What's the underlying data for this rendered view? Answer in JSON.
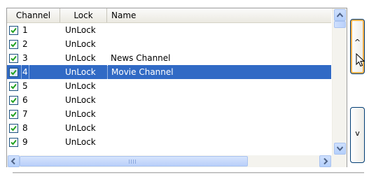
{
  "list": {
    "columns": [
      "Channel",
      "Lock",
      "Name"
    ],
    "rows": [
      {
        "channel": "1",
        "lock": "UnLock",
        "name": "",
        "checked": true,
        "selected": false
      },
      {
        "channel": "2",
        "lock": "UnLock",
        "name": "",
        "checked": true,
        "selected": false
      },
      {
        "channel": "3",
        "lock": "UnLock",
        "name": "News Channel",
        "checked": true,
        "selected": false
      },
      {
        "channel": "4",
        "lock": "UnLock",
        "name": "Movie Channel",
        "checked": true,
        "selected": true
      },
      {
        "channel": "5",
        "lock": "UnLock",
        "name": "",
        "checked": true,
        "selected": false
      },
      {
        "channel": "6",
        "lock": "UnLock",
        "name": "",
        "checked": true,
        "selected": false
      },
      {
        "channel": "7",
        "lock": "UnLock",
        "name": "",
        "checked": true,
        "selected": false
      },
      {
        "channel": "8",
        "lock": "UnLock",
        "name": "",
        "checked": true,
        "selected": false
      },
      {
        "channel": "9",
        "lock": "UnLock",
        "name": "",
        "checked": true,
        "selected": false
      }
    ]
  },
  "side_buttons": {
    "up_label": "^",
    "down_label": "v"
  },
  "colors": {
    "selection": "#316ac5",
    "checkmark": "#21a121",
    "scroll_arrow": "#4d6185"
  },
  "icons": [
    "scroll-up-icon",
    "scroll-down-icon",
    "scroll-left-icon",
    "scroll-right-icon",
    "checkmark-icon",
    "mouse-cursor-icon"
  ]
}
